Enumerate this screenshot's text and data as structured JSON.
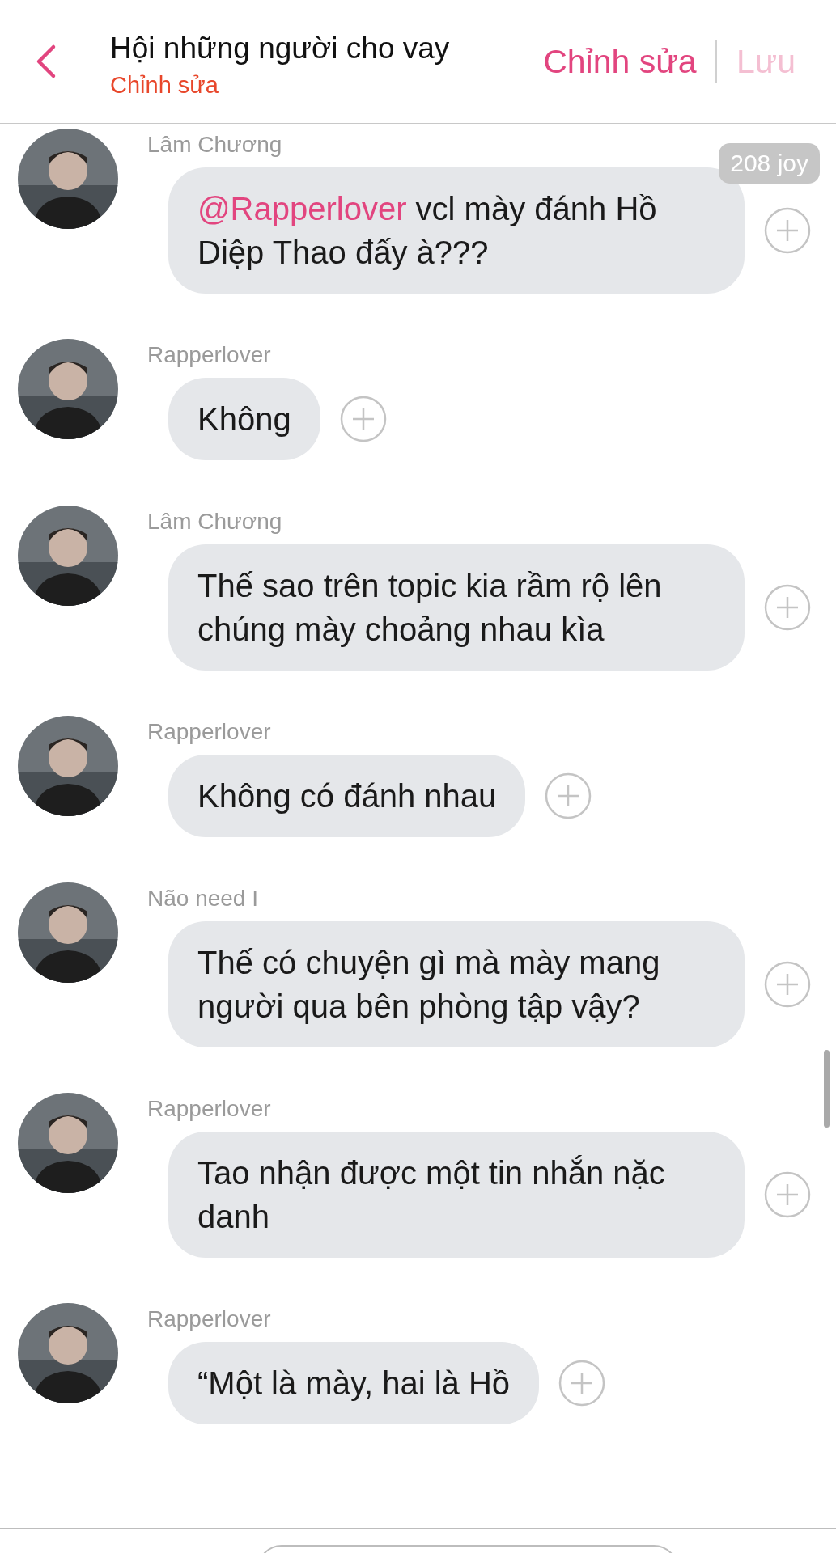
{
  "header": {
    "title": "Hội những người cho vay",
    "subtitle": "Chỉnh sửa",
    "actions": [
      {
        "label": "Chỉnh sửa",
        "disabled": false
      },
      {
        "label": "Lưu",
        "disabled": true
      }
    ]
  },
  "badge": "208 joy",
  "messages": [
    {
      "sender": "Lâm Chương",
      "mention": "@Rapperlover",
      "text": " vcl mày đánh Hồ Diệp Thao đấy à???"
    },
    {
      "sender": "Rapperlover",
      "text": "Không"
    },
    {
      "sender": "Lâm Chương",
      "text": "Thế sao trên topic kia rầm rộ lên chúng mày choảng nhau kìa"
    },
    {
      "sender": "Rapperlover",
      "text": "Không có đánh nhau"
    },
    {
      "sender": "Não need I",
      "text": "Thế có chuyện gì mà mày mang người qua bên phòng tập vậy?"
    },
    {
      "sender": "Rapperlover",
      "text": "Tao nhận được một tin nhắn nặc danh"
    },
    {
      "sender": "Rapperlover",
      "text": "“Một là mày, hai là Hồ"
    }
  ]
}
